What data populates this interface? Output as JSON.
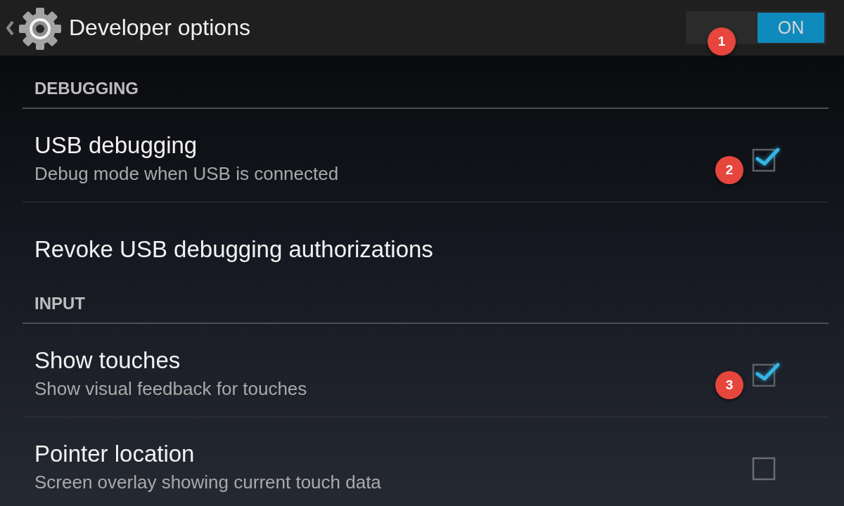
{
  "action_bar": {
    "title": "Developer options"
  },
  "master_switch": {
    "label": "ON",
    "on": true,
    "callout": "1"
  },
  "sections": [
    {
      "header": "DEBUGGING",
      "items": [
        {
          "kind": "checkbox",
          "title": "USB debugging",
          "summary": "Debug mode when USB is connected",
          "checked": true,
          "callout": "2"
        },
        {
          "kind": "action",
          "title": "Revoke USB debugging authorizations"
        }
      ]
    },
    {
      "header": "INPUT",
      "items": [
        {
          "kind": "checkbox",
          "title": "Show touches",
          "summary": "Show visual feedback for touches",
          "checked": true,
          "callout": "3"
        },
        {
          "kind": "checkbox",
          "title": "Pointer location",
          "summary": "Screen overlay showing current touch data",
          "checked": false
        }
      ]
    }
  ]
}
